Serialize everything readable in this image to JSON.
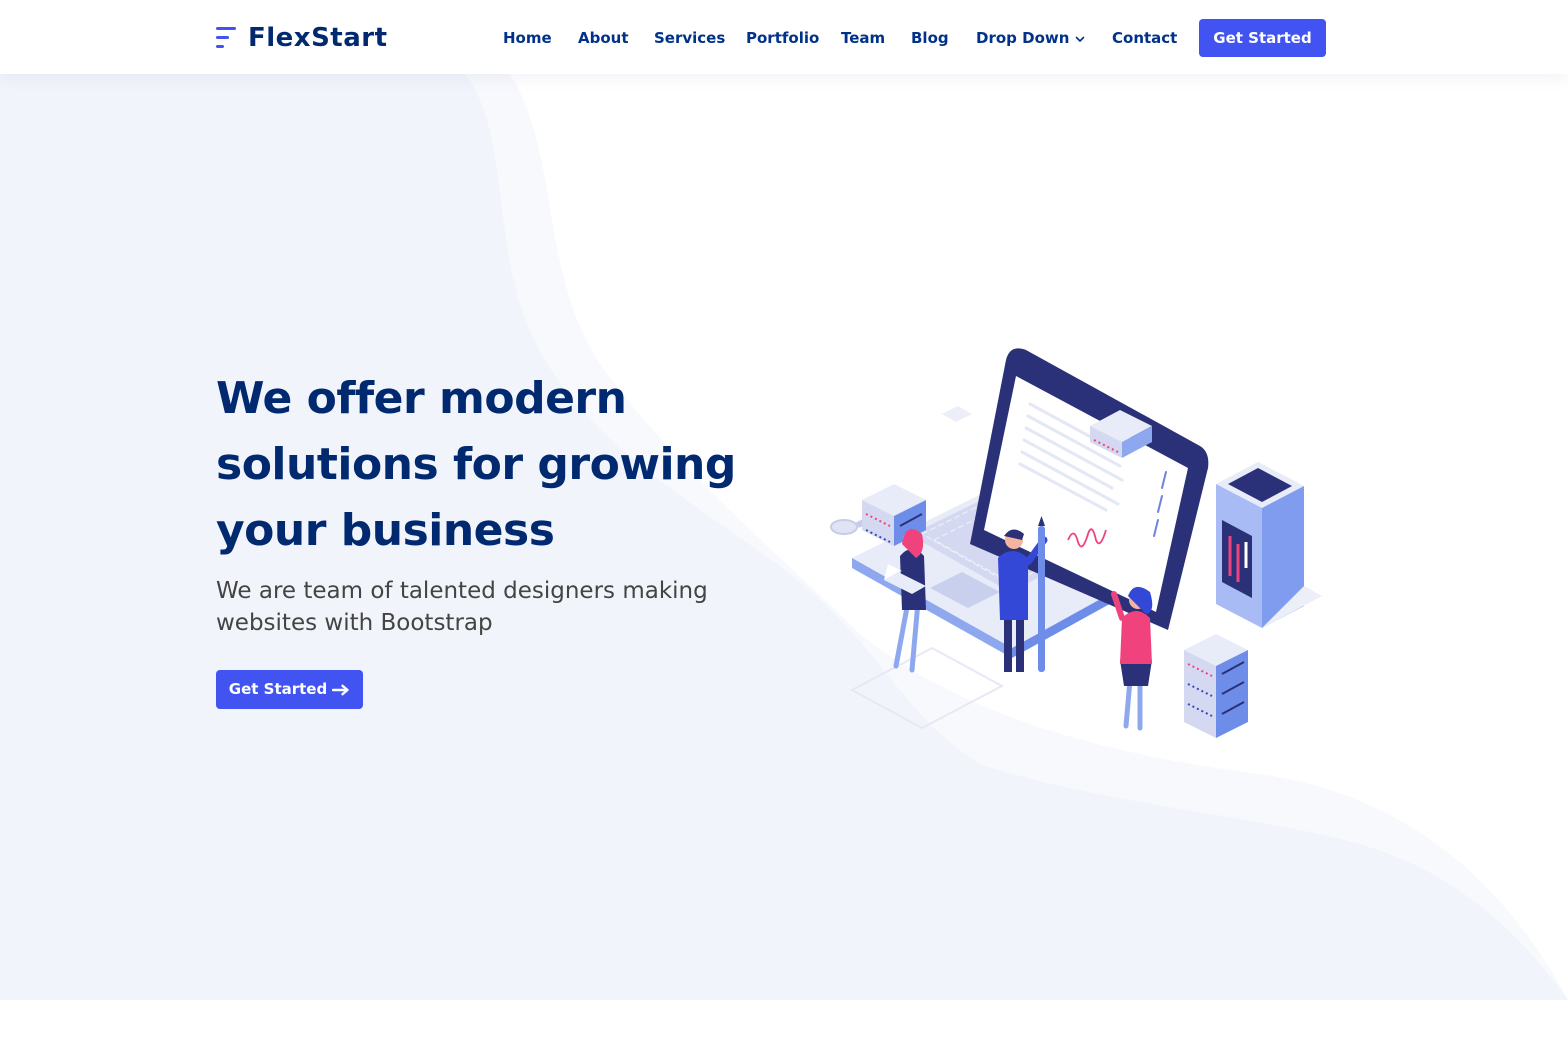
{
  "header": {
    "logo_text": "FlexStart",
    "nav": [
      {
        "label": "Home"
      },
      {
        "label": "About"
      },
      {
        "label": "Services"
      },
      {
        "label": "Portfolio"
      },
      {
        "label": "Team"
      },
      {
        "label": "Blog"
      },
      {
        "label": "Drop Down",
        "icon": "chevron-down-icon"
      },
      {
        "label": "Contact"
      }
    ],
    "cta_label": "Get Started"
  },
  "hero": {
    "title": "We offer modern solutions for growing your business",
    "subtitle": "We are team of talented designers making websites with Bootstrap",
    "button_label": "Get Started",
    "button_icon": "arrow-right-icon",
    "illustration": "isometric-team-laptop-illustration"
  },
  "colors": {
    "primary": "#4154f1",
    "heading": "#012970",
    "nav_text": "#013289",
    "body_text": "#444444",
    "hero_bg": "#f2f4fb",
    "accent_pink": "#f0437e"
  }
}
